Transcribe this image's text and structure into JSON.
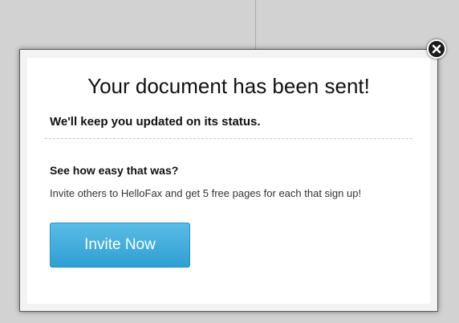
{
  "dialog": {
    "title": "Your document has been sent!",
    "subtitle": "We'll keep you updated on its status.",
    "section_heading": "See how easy that was?",
    "invite_text": "Invite others to HelloFax and get 5 free pages for each that sign up!",
    "invite_button_label": "Invite Now",
    "close_icon": "close-icon"
  },
  "colors": {
    "button_accent": "#3aa9dc",
    "close_button": "#1b1b1b",
    "page_background": "#d2d2d2"
  }
}
